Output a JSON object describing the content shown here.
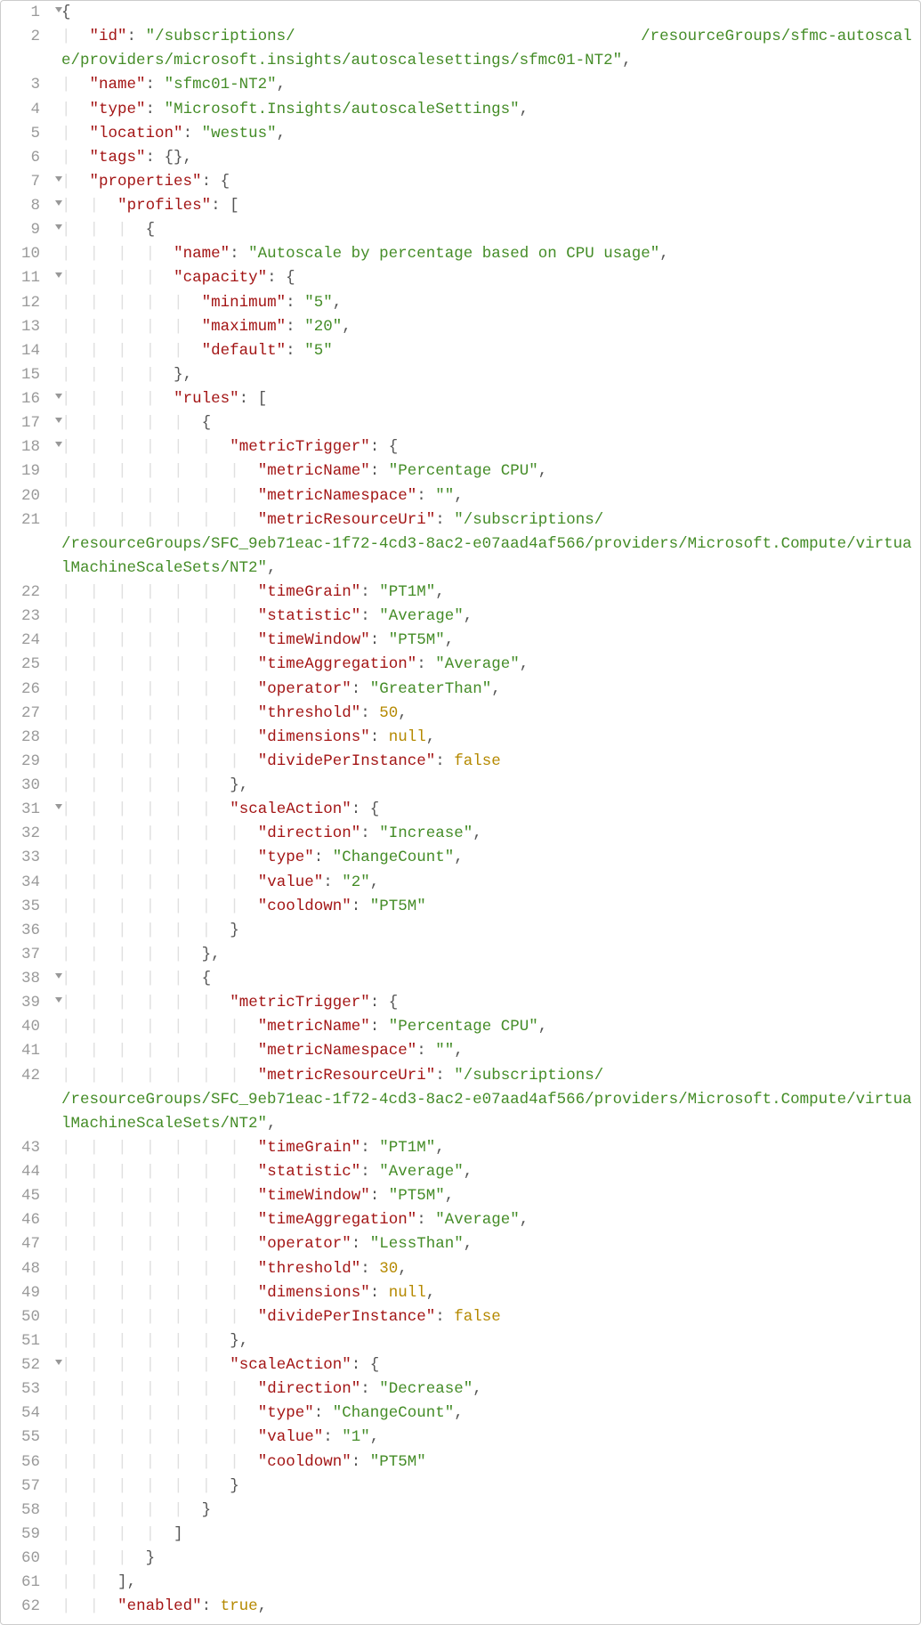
{
  "filetype": "json",
  "resource": {
    "id_prefix": "/subscriptions/",
    "id_suffix": "/resourceGroups/sfmc-autoscale/providers/microsoft.insights/autoscalesettings/sfmc01-NT2",
    "name": "sfmc01-NT2",
    "type": "Microsoft.Insights/autoscaleSettings",
    "location": "westus",
    "tags": "{}"
  },
  "metricResourceUri_prefix": "/subscriptions/",
  "metricResourceUri_suffix": "/resourceGroups/SFC_9eb71eac-1f72-4cd3-8ac2-e07aad4af566/providers/Microsoft.Compute/virtualMachineScaleSets/NT2",
  "profile": {
    "name": "Autoscale by percentage based on CPU usage",
    "capacity": {
      "minimum": "5",
      "maximum": "20",
      "default": "5"
    }
  },
  "rule1": {
    "metricTrigger": {
      "metricName": "Percentage CPU",
      "metricNamespace": "",
      "timeGrain": "PT1M",
      "statistic": "Average",
      "timeWindow": "PT5M",
      "timeAggregation": "Average",
      "operator": "GreaterThan",
      "threshold": 50,
      "dimensions": "null",
      "dividePerInstance": "false"
    },
    "scaleAction": {
      "direction": "Increase",
      "type": "ChangeCount",
      "value": "2",
      "cooldown": "PT5M"
    }
  },
  "rule2": {
    "metricTrigger": {
      "metricName": "Percentage CPU",
      "metricNamespace": "",
      "timeGrain": "PT1M",
      "statistic": "Average",
      "timeWindow": "PT5M",
      "timeAggregation": "Average",
      "operator": "LessThan",
      "threshold": 30,
      "dimensions": "null",
      "dividePerInstance": "false"
    },
    "scaleAction": {
      "direction": "Decrease",
      "type": "ChangeCount",
      "value": "1",
      "cooldown": "PT5M"
    }
  },
  "enabled": "true",
  "lines": [
    {
      "n": 1,
      "f": 1,
      "i": 0,
      "t": [
        {
          "p": "{"
        }
      ]
    },
    {
      "n": 2,
      "i": 1,
      "t": [
        {
          "k": "\"id\""
        },
        {
          "p": ": "
        },
        {
          "s": "\"/subscriptions/"
        },
        {
          "p": "                                     "
        },
        {
          "s": "/resourceGroups/sfmc-autoscale/providers/microsoft.insights/autoscalesettings/sfmc01-NT2\""
        },
        {
          "p": ","
        }
      ]
    },
    {
      "n": 3,
      "i": 1,
      "t": [
        {
          "k": "\"name\""
        },
        {
          "p": ": "
        },
        {
          "s": "\"sfmc01-NT2\""
        },
        {
          "p": ","
        }
      ]
    },
    {
      "n": 4,
      "i": 1,
      "t": [
        {
          "k": "\"type\""
        },
        {
          "p": ": "
        },
        {
          "s": "\"Microsoft.Insights/autoscaleSettings\""
        },
        {
          "p": ","
        }
      ]
    },
    {
      "n": 5,
      "i": 1,
      "t": [
        {
          "k": "\"location\""
        },
        {
          "p": ": "
        },
        {
          "s": "\"westus\""
        },
        {
          "p": ","
        }
      ]
    },
    {
      "n": 6,
      "i": 1,
      "t": [
        {
          "k": "\"tags\""
        },
        {
          "p": ": {},"
        }
      ]
    },
    {
      "n": 7,
      "f": 1,
      "i": 1,
      "t": [
        {
          "k": "\"properties\""
        },
        {
          "p": ": {"
        }
      ]
    },
    {
      "n": 8,
      "f": 1,
      "i": 2,
      "t": [
        {
          "k": "\"profiles\""
        },
        {
          "p": ": ["
        }
      ]
    },
    {
      "n": 9,
      "f": 1,
      "i": 3,
      "t": [
        {
          "p": "{"
        }
      ]
    },
    {
      "n": 10,
      "i": 4,
      "t": [
        {
          "k": "\"name\""
        },
        {
          "p": ": "
        },
        {
          "s": "\"Autoscale by percentage based on CPU usage\""
        },
        {
          "p": ","
        }
      ]
    },
    {
      "n": 11,
      "f": 1,
      "i": 4,
      "t": [
        {
          "k": "\"capacity\""
        },
        {
          "p": ": {"
        }
      ]
    },
    {
      "n": 12,
      "i": 5,
      "t": [
        {
          "k": "\"minimum\""
        },
        {
          "p": ": "
        },
        {
          "s": "\"5\""
        },
        {
          "p": ","
        }
      ]
    },
    {
      "n": 13,
      "i": 5,
      "t": [
        {
          "k": "\"maximum\""
        },
        {
          "p": ": "
        },
        {
          "s": "\"20\""
        },
        {
          "p": ","
        }
      ]
    },
    {
      "n": 14,
      "i": 5,
      "t": [
        {
          "k": "\"default\""
        },
        {
          "p": ": "
        },
        {
          "s": "\"5\""
        }
      ]
    },
    {
      "n": 15,
      "i": 4,
      "t": [
        {
          "p": "},"
        }
      ]
    },
    {
      "n": 16,
      "f": 1,
      "i": 4,
      "t": [
        {
          "k": "\"rules\""
        },
        {
          "p": ": ["
        }
      ]
    },
    {
      "n": 17,
      "f": 1,
      "i": 5,
      "t": [
        {
          "p": "{"
        }
      ]
    },
    {
      "n": 18,
      "f": 1,
      "i": 6,
      "t": [
        {
          "k": "\"metricTrigger\""
        },
        {
          "p": ": {"
        }
      ]
    },
    {
      "n": 19,
      "i": 7,
      "t": [
        {
          "k": "\"metricName\""
        },
        {
          "p": ": "
        },
        {
          "s": "\"Percentage CPU\""
        },
        {
          "p": ","
        }
      ]
    },
    {
      "n": 20,
      "i": 7,
      "t": [
        {
          "k": "\"metricNamespace\""
        },
        {
          "p": ": "
        },
        {
          "s": "\"\""
        },
        {
          "p": ","
        }
      ]
    },
    {
      "n": 21,
      "i": 7,
      "t": [
        {
          "k": "\"metricResourceUri\""
        },
        {
          "p": ": "
        },
        {
          "s": "\"/subscriptions/"
        },
        {
          "p": "                                   "
        },
        {
          "s": "/resourceGroups/SFC_9eb71eac-1f72-4cd3-8ac2-e07aad4af566/providers/Microsoft.Compute/virtualMachineScaleSets/NT2\""
        },
        {
          "p": ","
        }
      ]
    },
    {
      "n": 22,
      "i": 7,
      "t": [
        {
          "k": "\"timeGrain\""
        },
        {
          "p": ": "
        },
        {
          "s": "\"PT1M\""
        },
        {
          "p": ","
        }
      ]
    },
    {
      "n": 23,
      "i": 7,
      "t": [
        {
          "k": "\"statistic\""
        },
        {
          "p": ": "
        },
        {
          "s": "\"Average\""
        },
        {
          "p": ","
        }
      ]
    },
    {
      "n": 24,
      "i": 7,
      "t": [
        {
          "k": "\"timeWindow\""
        },
        {
          "p": ": "
        },
        {
          "s": "\"PT5M\""
        },
        {
          "p": ","
        }
      ]
    },
    {
      "n": 25,
      "i": 7,
      "t": [
        {
          "k": "\"timeAggregation\""
        },
        {
          "p": ": "
        },
        {
          "s": "\"Average\""
        },
        {
          "p": ","
        }
      ]
    },
    {
      "n": 26,
      "i": 7,
      "t": [
        {
          "k": "\"operator\""
        },
        {
          "p": ": "
        },
        {
          "s": "\"GreaterThan\""
        },
        {
          "p": ","
        }
      ]
    },
    {
      "n": 27,
      "i": 7,
      "t": [
        {
          "k": "\"threshold\""
        },
        {
          "p": ": "
        },
        {
          "num": "50"
        },
        {
          "p": ","
        }
      ]
    },
    {
      "n": 28,
      "i": 7,
      "t": [
        {
          "k": "\"dimensions\""
        },
        {
          "p": ": "
        },
        {
          "kw": "null"
        },
        {
          "p": ","
        }
      ]
    },
    {
      "n": 29,
      "i": 7,
      "t": [
        {
          "k": "\"dividePerInstance\""
        },
        {
          "p": ": "
        },
        {
          "kw": "false"
        }
      ]
    },
    {
      "n": 30,
      "i": 6,
      "t": [
        {
          "p": "},"
        }
      ]
    },
    {
      "n": 31,
      "f": 1,
      "i": 6,
      "t": [
        {
          "k": "\"scaleAction\""
        },
        {
          "p": ": {"
        }
      ]
    },
    {
      "n": 32,
      "i": 7,
      "t": [
        {
          "k": "\"direction\""
        },
        {
          "p": ": "
        },
        {
          "s": "\"Increase\""
        },
        {
          "p": ","
        }
      ]
    },
    {
      "n": 33,
      "i": 7,
      "t": [
        {
          "k": "\"type\""
        },
        {
          "p": ": "
        },
        {
          "s": "\"ChangeCount\""
        },
        {
          "p": ","
        }
      ]
    },
    {
      "n": 34,
      "i": 7,
      "t": [
        {
          "k": "\"value\""
        },
        {
          "p": ": "
        },
        {
          "s": "\"2\""
        },
        {
          "p": ","
        }
      ]
    },
    {
      "n": 35,
      "i": 7,
      "t": [
        {
          "k": "\"cooldown\""
        },
        {
          "p": ": "
        },
        {
          "s": "\"PT5M\""
        }
      ]
    },
    {
      "n": 36,
      "i": 6,
      "t": [
        {
          "p": "}"
        }
      ]
    },
    {
      "n": 37,
      "i": 5,
      "t": [
        {
          "p": "},"
        }
      ]
    },
    {
      "n": 38,
      "f": 1,
      "i": 5,
      "t": [
        {
          "p": "{"
        }
      ]
    },
    {
      "n": 39,
      "f": 1,
      "i": 6,
      "t": [
        {
          "k": "\"metricTrigger\""
        },
        {
          "p": ": {"
        }
      ]
    },
    {
      "n": 40,
      "i": 7,
      "t": [
        {
          "k": "\"metricName\""
        },
        {
          "p": ": "
        },
        {
          "s": "\"Percentage CPU\""
        },
        {
          "p": ","
        }
      ]
    },
    {
      "n": 41,
      "i": 7,
      "t": [
        {
          "k": "\"metricNamespace\""
        },
        {
          "p": ": "
        },
        {
          "s": "\"\""
        },
        {
          "p": ","
        }
      ]
    },
    {
      "n": 42,
      "i": 7,
      "t": [
        {
          "k": "\"metricResourceUri\""
        },
        {
          "p": ": "
        },
        {
          "s": "\"/subscriptions/"
        },
        {
          "p": "                                   "
        },
        {
          "s": "/resourceGroups/SFC_9eb71eac-1f72-4cd3-8ac2-e07aad4af566/providers/Microsoft.Compute/virtualMachineScaleSets/NT2\""
        },
        {
          "p": ","
        }
      ]
    },
    {
      "n": 43,
      "i": 7,
      "t": [
        {
          "k": "\"timeGrain\""
        },
        {
          "p": ": "
        },
        {
          "s": "\"PT1M\""
        },
        {
          "p": ","
        }
      ]
    },
    {
      "n": 44,
      "i": 7,
      "t": [
        {
          "k": "\"statistic\""
        },
        {
          "p": ": "
        },
        {
          "s": "\"Average\""
        },
        {
          "p": ","
        }
      ]
    },
    {
      "n": 45,
      "i": 7,
      "t": [
        {
          "k": "\"timeWindow\""
        },
        {
          "p": ": "
        },
        {
          "s": "\"PT5M\""
        },
        {
          "p": ","
        }
      ]
    },
    {
      "n": 46,
      "i": 7,
      "t": [
        {
          "k": "\"timeAggregation\""
        },
        {
          "p": ": "
        },
        {
          "s": "\"Average\""
        },
        {
          "p": ","
        }
      ]
    },
    {
      "n": 47,
      "i": 7,
      "t": [
        {
          "k": "\"operator\""
        },
        {
          "p": ": "
        },
        {
          "s": "\"LessThan\""
        },
        {
          "p": ","
        }
      ]
    },
    {
      "n": 48,
      "i": 7,
      "t": [
        {
          "k": "\"threshold\""
        },
        {
          "p": ": "
        },
        {
          "num": "30"
        },
        {
          "p": ","
        }
      ]
    },
    {
      "n": 49,
      "i": 7,
      "t": [
        {
          "k": "\"dimensions\""
        },
        {
          "p": ": "
        },
        {
          "kw": "null"
        },
        {
          "p": ","
        }
      ]
    },
    {
      "n": 50,
      "i": 7,
      "t": [
        {
          "k": "\"dividePerInstance\""
        },
        {
          "p": ": "
        },
        {
          "kw": "false"
        }
      ]
    },
    {
      "n": 51,
      "i": 6,
      "t": [
        {
          "p": "},"
        }
      ]
    },
    {
      "n": 52,
      "f": 1,
      "i": 6,
      "t": [
        {
          "k": "\"scaleAction\""
        },
        {
          "p": ": {"
        }
      ]
    },
    {
      "n": 53,
      "i": 7,
      "t": [
        {
          "k": "\"direction\""
        },
        {
          "p": ": "
        },
        {
          "s": "\"Decrease\""
        },
        {
          "p": ","
        }
      ]
    },
    {
      "n": 54,
      "i": 7,
      "t": [
        {
          "k": "\"type\""
        },
        {
          "p": ": "
        },
        {
          "s": "\"ChangeCount\""
        },
        {
          "p": ","
        }
      ]
    },
    {
      "n": 55,
      "i": 7,
      "t": [
        {
          "k": "\"value\""
        },
        {
          "p": ": "
        },
        {
          "s": "\"1\""
        },
        {
          "p": ","
        }
      ]
    },
    {
      "n": 56,
      "i": 7,
      "t": [
        {
          "k": "\"cooldown\""
        },
        {
          "p": ": "
        },
        {
          "s": "\"PT5M\""
        }
      ]
    },
    {
      "n": 57,
      "i": 6,
      "t": [
        {
          "p": "}"
        }
      ]
    },
    {
      "n": 58,
      "i": 5,
      "t": [
        {
          "p": "}"
        }
      ]
    },
    {
      "n": 59,
      "i": 4,
      "t": [
        {
          "p": "]"
        }
      ]
    },
    {
      "n": 60,
      "i": 3,
      "t": [
        {
          "p": "}"
        }
      ]
    },
    {
      "n": 61,
      "i": 2,
      "t": [
        {
          "p": "],"
        }
      ]
    },
    {
      "n": 62,
      "i": 2,
      "t": [
        {
          "k": "\"enabled\""
        },
        {
          "p": ": "
        },
        {
          "kw": "true"
        },
        {
          "p": ","
        }
      ]
    }
  ]
}
